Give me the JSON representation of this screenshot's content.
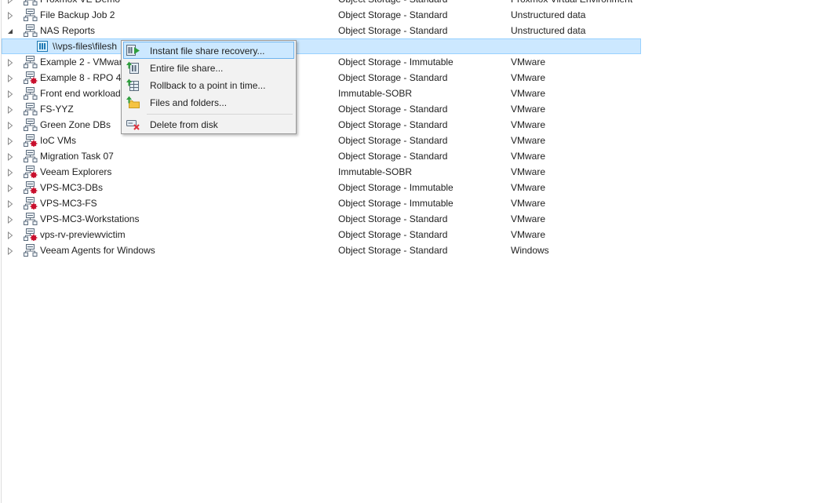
{
  "rows": [
    {
      "name": "Proxmox VE Demo",
      "repo": "Object Storage - Standard",
      "platform": "Proxmox Virtual Environment",
      "icon": "backup-job-icon",
      "state": "collapsed"
    },
    {
      "name": "File Backup Job 2",
      "repo": "Object Storage - Standard",
      "platform": "Unstructured data",
      "icon": "backup-job-icon",
      "state": "collapsed"
    },
    {
      "name": "NAS Reports",
      "repo": "Object Storage - Standard",
      "platform": "Unstructured data",
      "icon": "backup-job-icon",
      "state": "expanded"
    },
    {
      "name": "\\\\vps-files\\filesh",
      "repo": "",
      "platform": "",
      "icon": "file-share-icon",
      "state": "child-selected"
    },
    {
      "name": "Example 2 - VMwar",
      "repo": "Object Storage - Immutable",
      "platform": "VMware",
      "icon": "backup-job-icon",
      "state": "collapsed"
    },
    {
      "name": "Example 8 - RPO 4 I",
      "repo": "Object Storage - Standard",
      "platform": "VMware",
      "icon": "backup-job-warning-icon",
      "state": "collapsed"
    },
    {
      "name": "Front end workload",
      "repo": "Immutable-SOBR",
      "platform": "VMware",
      "icon": "backup-job-icon",
      "state": "collapsed"
    },
    {
      "name": "FS-YYZ",
      "repo": "Object Storage - Standard",
      "platform": "VMware",
      "icon": "backup-job-icon",
      "state": "collapsed"
    },
    {
      "name": "Green Zone DBs",
      "repo": "Object Storage - Standard",
      "platform": "VMware",
      "icon": "backup-job-icon",
      "state": "collapsed"
    },
    {
      "name": "IoC VMs",
      "repo": "Object Storage - Standard",
      "platform": "VMware",
      "icon": "backup-job-warning-icon",
      "state": "collapsed"
    },
    {
      "name": "Migration Task 07",
      "repo": "Object Storage - Standard",
      "platform": "VMware",
      "icon": "backup-job-icon",
      "state": "collapsed"
    },
    {
      "name": "Veeam Explorers",
      "repo": "Immutable-SOBR",
      "platform": "VMware",
      "icon": "backup-job-warning-icon",
      "state": "collapsed"
    },
    {
      "name": "VPS-MC3-DBs",
      "repo": "Object Storage - Immutable",
      "platform": "VMware",
      "icon": "backup-job-warning-icon",
      "state": "collapsed"
    },
    {
      "name": "VPS-MC3-FS",
      "repo": "Object Storage - Immutable",
      "platform": "VMware",
      "icon": "backup-job-warning-icon",
      "state": "collapsed"
    },
    {
      "name": "VPS-MC3-Workstations",
      "repo": "Object Storage - Standard",
      "platform": "VMware",
      "icon": "backup-job-icon",
      "state": "collapsed"
    },
    {
      "name": "vps-rv-previewvictim",
      "repo": "Object Storage - Standard",
      "platform": "VMware",
      "icon": "backup-job-warning-icon",
      "state": "collapsed"
    },
    {
      "name": "Veeam Agents for Windows",
      "repo": "Object Storage - Standard",
      "platform": "Windows",
      "icon": "backup-job-icon",
      "state": "collapsed"
    }
  ],
  "context_menu": {
    "items": [
      {
        "label": "Instant file share recovery...",
        "icon": "instant-recovery-icon",
        "highlighted": true
      },
      {
        "label": "Entire file share...",
        "icon": "entire-share-icon",
        "highlighted": false
      },
      {
        "label": "Rollback to a point in time...",
        "icon": "rollback-icon",
        "highlighted": false
      },
      {
        "label": "Files and folders...",
        "icon": "folder-restore-icon",
        "highlighted": false
      },
      {
        "label": "Delete from disk",
        "icon": "delete-disk-icon",
        "highlighted": false
      }
    ]
  },
  "colors": {
    "selection": "#cce8ff",
    "selection_border": "#99d1ff",
    "menu_background": "#f2f2f2",
    "menu_highlight_border": "#6eb4ee",
    "warning_red": "#c8102e",
    "restore_green": "#2e9e3c"
  }
}
